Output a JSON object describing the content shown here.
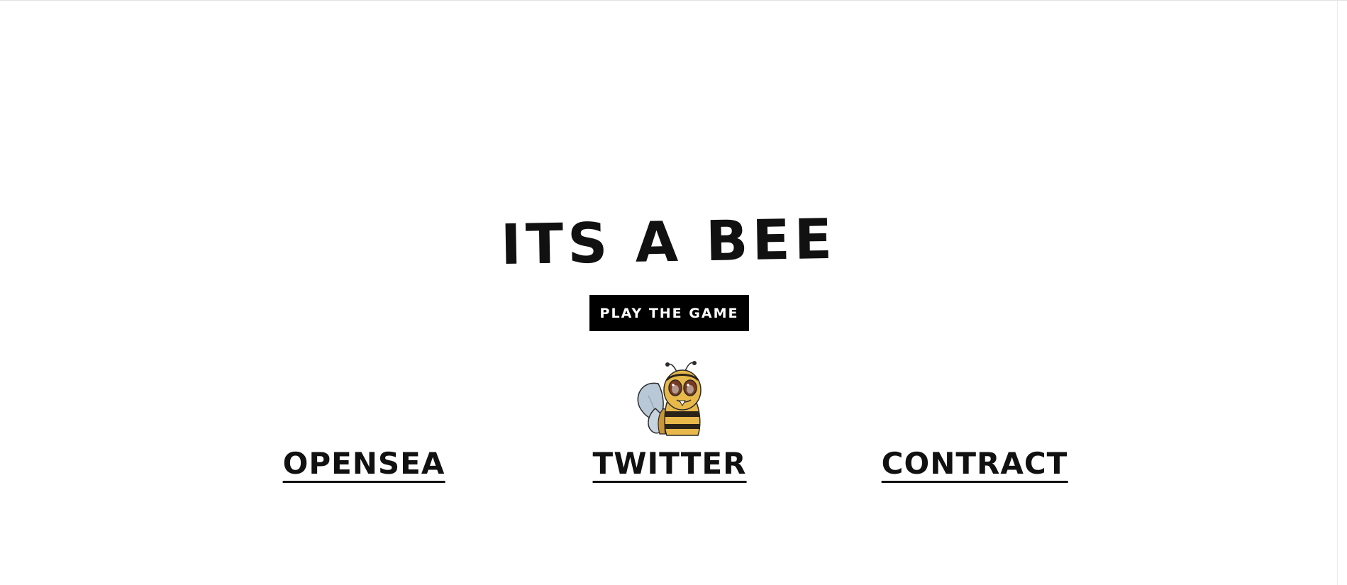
{
  "page": {
    "title": "ITS A BEE"
  },
  "hero": {
    "play_button_label": "PLAY THE GAME",
    "mascot_icon": "bee-mascot-icon"
  },
  "links": [
    {
      "label": "OPENSEA"
    },
    {
      "label": "TWITTER"
    },
    {
      "label": "CONTRACT"
    }
  ],
  "colors": {
    "background": "#ffffff",
    "text": "#111111",
    "button_bg": "#000000",
    "button_text": "#ffffff",
    "bee_yellow": "#e8b94a",
    "bee_stripe": "#2a2418",
    "bee_wing": "#b9c8d6",
    "bee_eye": "#7a3a22"
  }
}
